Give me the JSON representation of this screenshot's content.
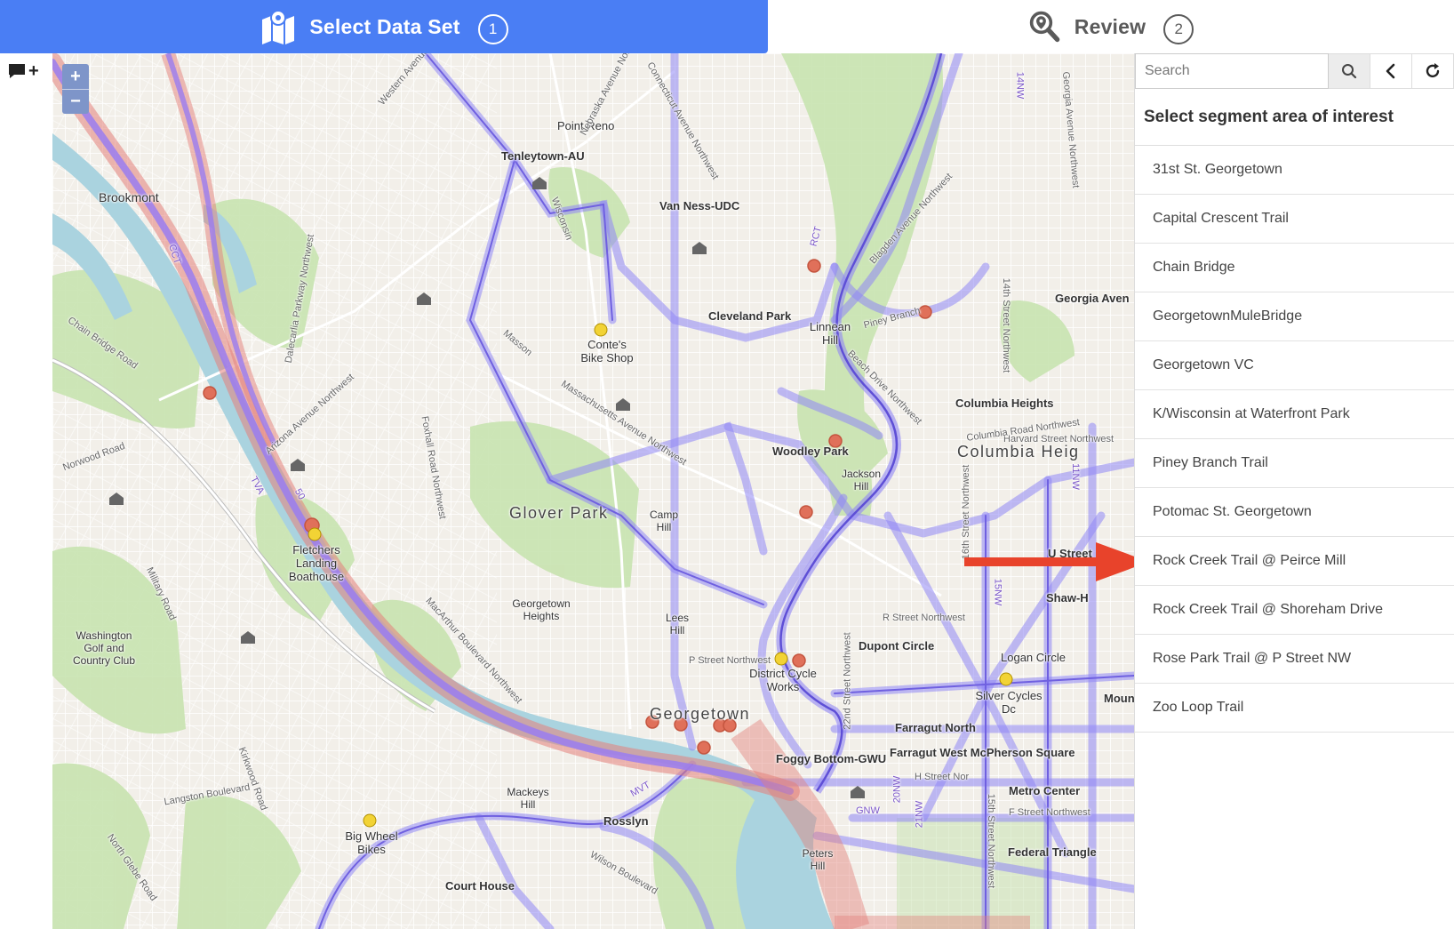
{
  "stepper": {
    "step1": {
      "label": "Select Data Set",
      "number": "1",
      "icon": "map-icon"
    },
    "step2": {
      "label": "Review",
      "number": "2",
      "icon": "magnify-pin-icon"
    }
  },
  "toolbar": {
    "comment_icon": "add-comment-icon",
    "comment_label": "+"
  },
  "map": {
    "zoom_in": "+",
    "zoom_out": "−",
    "places": [
      "Brookmont",
      "Tenleytown-AU",
      "Point Reno",
      "Van Ness-UDC",
      "Cleveland Park",
      "Conte's Bike Shop",
      "Linnean Hill",
      "Georgia Aven",
      "Woodley Park",
      "Jackson Hill",
      "Columbia Heights",
      "Columbia Heig",
      "Glover Park",
      "Camp Hill",
      "Fletchers Landing Boathouse",
      "Washington Golf and Country Club",
      "Georgetown Heights",
      "Lees Hill",
      "District Cycle Works",
      "Dupont Circle",
      "Logan Circle",
      "Silver Cycles Dc",
      "Georgetown",
      "Farragut North",
      "Foggy Bottom-GWU",
      "Farragut West McPherson Square",
      "Metro Center",
      "Mackeys Hill",
      "Rosslyn",
      "Big Wheel Bikes",
      "Peters Hill",
      "Federal Triangle",
      "Court House",
      "U Street",
      "Shaw-H",
      "Mount",
      "H Street Nor",
      "F Street Northwest",
      "R Street Northwest",
      "P Street Northwest"
    ],
    "roads": [
      "Western Avenue",
      "Nebraska Avenue Northwest",
      "Connecticut Avenue Northwest",
      "Wisconsin",
      "Dalecarlia Parkway Northwest",
      "Massachusetts Avenue Northwest",
      "Foxhall Road Northwest",
      "Arizona Avenue Northwest",
      "Chain Bridge Road",
      "Norwood Road",
      "MacArthur Boulevard Northwest",
      "Military Road",
      "Beach Drive Northwest",
      "Blagden Avenue Northwest",
      "Piney Branch",
      "Harvard Street Northwest",
      "Columbia Road Northwest",
      "14th Street Northwest",
      "Georgia Avenue Northwest",
      "16th Street Northwest",
      "22nd Street Northwest",
      "15th Street Northwest",
      "Langston Boulevard",
      "Wilson Boulevard",
      "Kirkwood Road",
      "North Glebe Road",
      "Masson",
      "14NW",
      "11NW",
      "RCT",
      "CCT",
      "TVA",
      "MVT",
      "GNW",
      "20NW",
      "21NW",
      "50",
      "15NW"
    ]
  },
  "panel": {
    "search_placeholder": "Search",
    "search_icon": "search-icon",
    "back_icon": "chevron-left-icon",
    "refresh_icon": "refresh-icon",
    "title": "Select segment area of interest",
    "segments": [
      "31st St. Georgetown",
      "Capital Crescent Trail",
      "Chain Bridge",
      "GeorgetownMuleBridge",
      "Georgetown VC",
      "K/Wisconsin at Waterfront Park",
      "Piney Branch Trail",
      "Potomac St. Georgetown",
      "Rock Creek Trail @ Peirce Mill",
      "Rock Creek Trail @ Shoreham Drive",
      "Rose Park Trail @ P Street NW",
      "Zoo Loop Trail"
    ]
  },
  "annotation": {
    "arrow_color": "#e8432b",
    "points_to": "Rock Creek Trail @ Peirce Mill"
  },
  "colors": {
    "accent": "#4a7ef4",
    "trail_purple": "#9b7ff0",
    "river": "#aad3df",
    "park": "#c8e3b0",
    "land": "#f2efe9",
    "hotspot": "#e0705a"
  }
}
